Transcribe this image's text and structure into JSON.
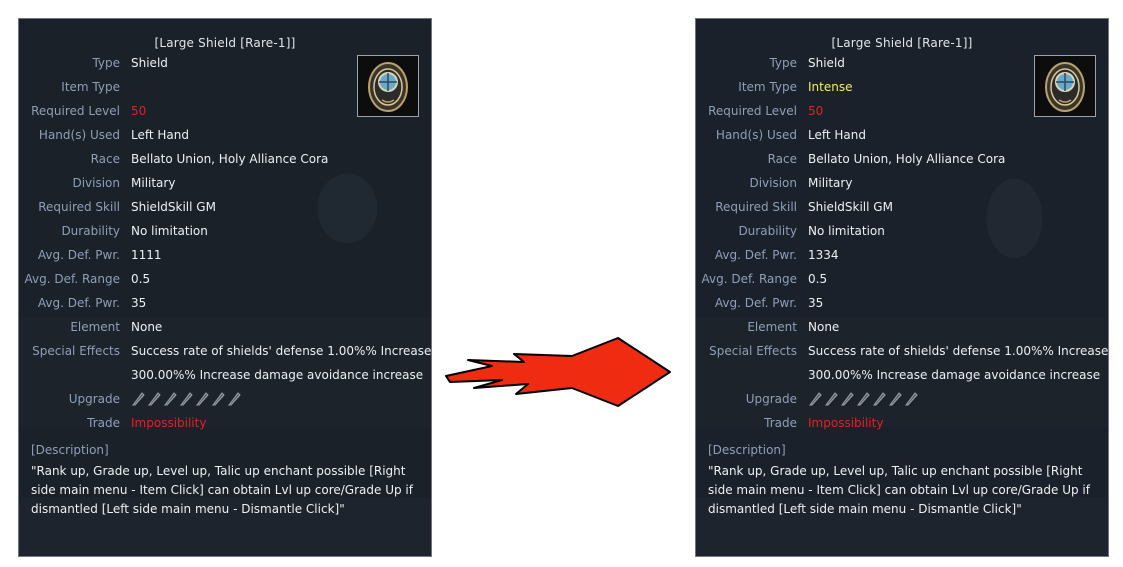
{
  "tooltips": [
    {
      "title": "[Large Shield [Rare-1]]",
      "rows": [
        {
          "label": "Type",
          "value": "Shield",
          "color": "white"
        },
        {
          "label": "Item Type",
          "value": "",
          "color": "white"
        },
        {
          "label": "Required Level",
          "value": "50",
          "color": "red"
        },
        {
          "label": "Hand(s) Used",
          "value": "Left Hand",
          "color": "white"
        },
        {
          "label": "Race",
          "value": "Bellato Union, Holy Alliance Cora",
          "color": "white"
        },
        {
          "label": "Division",
          "value": "Military",
          "color": "white"
        },
        {
          "label": "Required Skill",
          "value": "ShieldSkill GM",
          "color": "white"
        },
        {
          "label": "Durability",
          "value": "No limitation",
          "color": "white"
        },
        {
          "label": "Avg. Def. Pwr.",
          "value": "1111",
          "color": "white"
        },
        {
          "label": "Avg. Def. Range",
          "value": "0.5",
          "color": "white"
        },
        {
          "label": "Avg. Def. Pwr.",
          "value": "35",
          "color": "white"
        },
        {
          "label": "Element",
          "value": "None",
          "color": "white"
        },
        {
          "label": "Special Effects",
          "value": "Success rate of shields' defense 1.00%% Increase",
          "color": "white"
        },
        {
          "label": "",
          "value": "300.00%% Increase damage avoidance increase",
          "color": "white"
        },
        {
          "label": "Upgrade",
          "value": "",
          "color": "white"
        },
        {
          "label": "Trade",
          "value": "Impossibility",
          "color": "red"
        }
      ],
      "description_header": "[Description]",
      "description": "\"Rank up, Grade up, Level up, Talic up enchant possible [Right side main menu - Item Click] can obtain Lvl up core/Grade Up if dismantled [Left side main menu - Dismantle Click]\"",
      "upgrade_slots": 7,
      "icon": "shield-icon"
    },
    {
      "title": "[Large Shield [Rare-1]]",
      "rows": [
        {
          "label": "Type",
          "value": "Shield",
          "color": "white"
        },
        {
          "label": "Item Type",
          "value": "Intense",
          "color": "yellow"
        },
        {
          "label": "Required Level",
          "value": "50",
          "color": "red"
        },
        {
          "label": "Hand(s) Used",
          "value": "Left Hand",
          "color": "white"
        },
        {
          "label": "Race",
          "value": "Bellato Union, Holy Alliance Cora",
          "color": "white"
        },
        {
          "label": "Division",
          "value": "Military",
          "color": "white"
        },
        {
          "label": "Required Skill",
          "value": "ShieldSkill GM",
          "color": "white"
        },
        {
          "label": "Durability",
          "value": "No limitation",
          "color": "white"
        },
        {
          "label": "Avg. Def. Pwr.",
          "value": "1334",
          "color": "white"
        },
        {
          "label": "Avg. Def. Range",
          "value": "0.5",
          "color": "white"
        },
        {
          "label": "Avg. Def. Pwr.",
          "value": "35",
          "color": "white"
        },
        {
          "label": "Element",
          "value": "None",
          "color": "white"
        },
        {
          "label": "Special Effects",
          "value": "Success rate of shields' defense 1.00%% Increase",
          "color": "white"
        },
        {
          "label": "",
          "value": "300.00%% Increase damage avoidance increase",
          "color": "white"
        },
        {
          "label": "Upgrade",
          "value": "",
          "color": "white"
        },
        {
          "label": "Trade",
          "value": "Impossibility",
          "color": "red"
        }
      ],
      "description_header": "[Description]",
      "description": "\"Rank up, Grade up, Level up, Talic up enchant possible [Right side main menu - Item Click] can obtain Lvl up core/Grade Up if dismantled [Left side main menu - Dismantle Click]\"",
      "upgrade_slots": 7,
      "icon": "shield-icon"
    }
  ],
  "arrow_icon": "right-arrow-icon",
  "colors": {
    "label": "#8e9fb8",
    "value": "#eef0f2",
    "red": "#e02222",
    "yellow": "#f3ee63",
    "arrow": "#ef2b12"
  }
}
